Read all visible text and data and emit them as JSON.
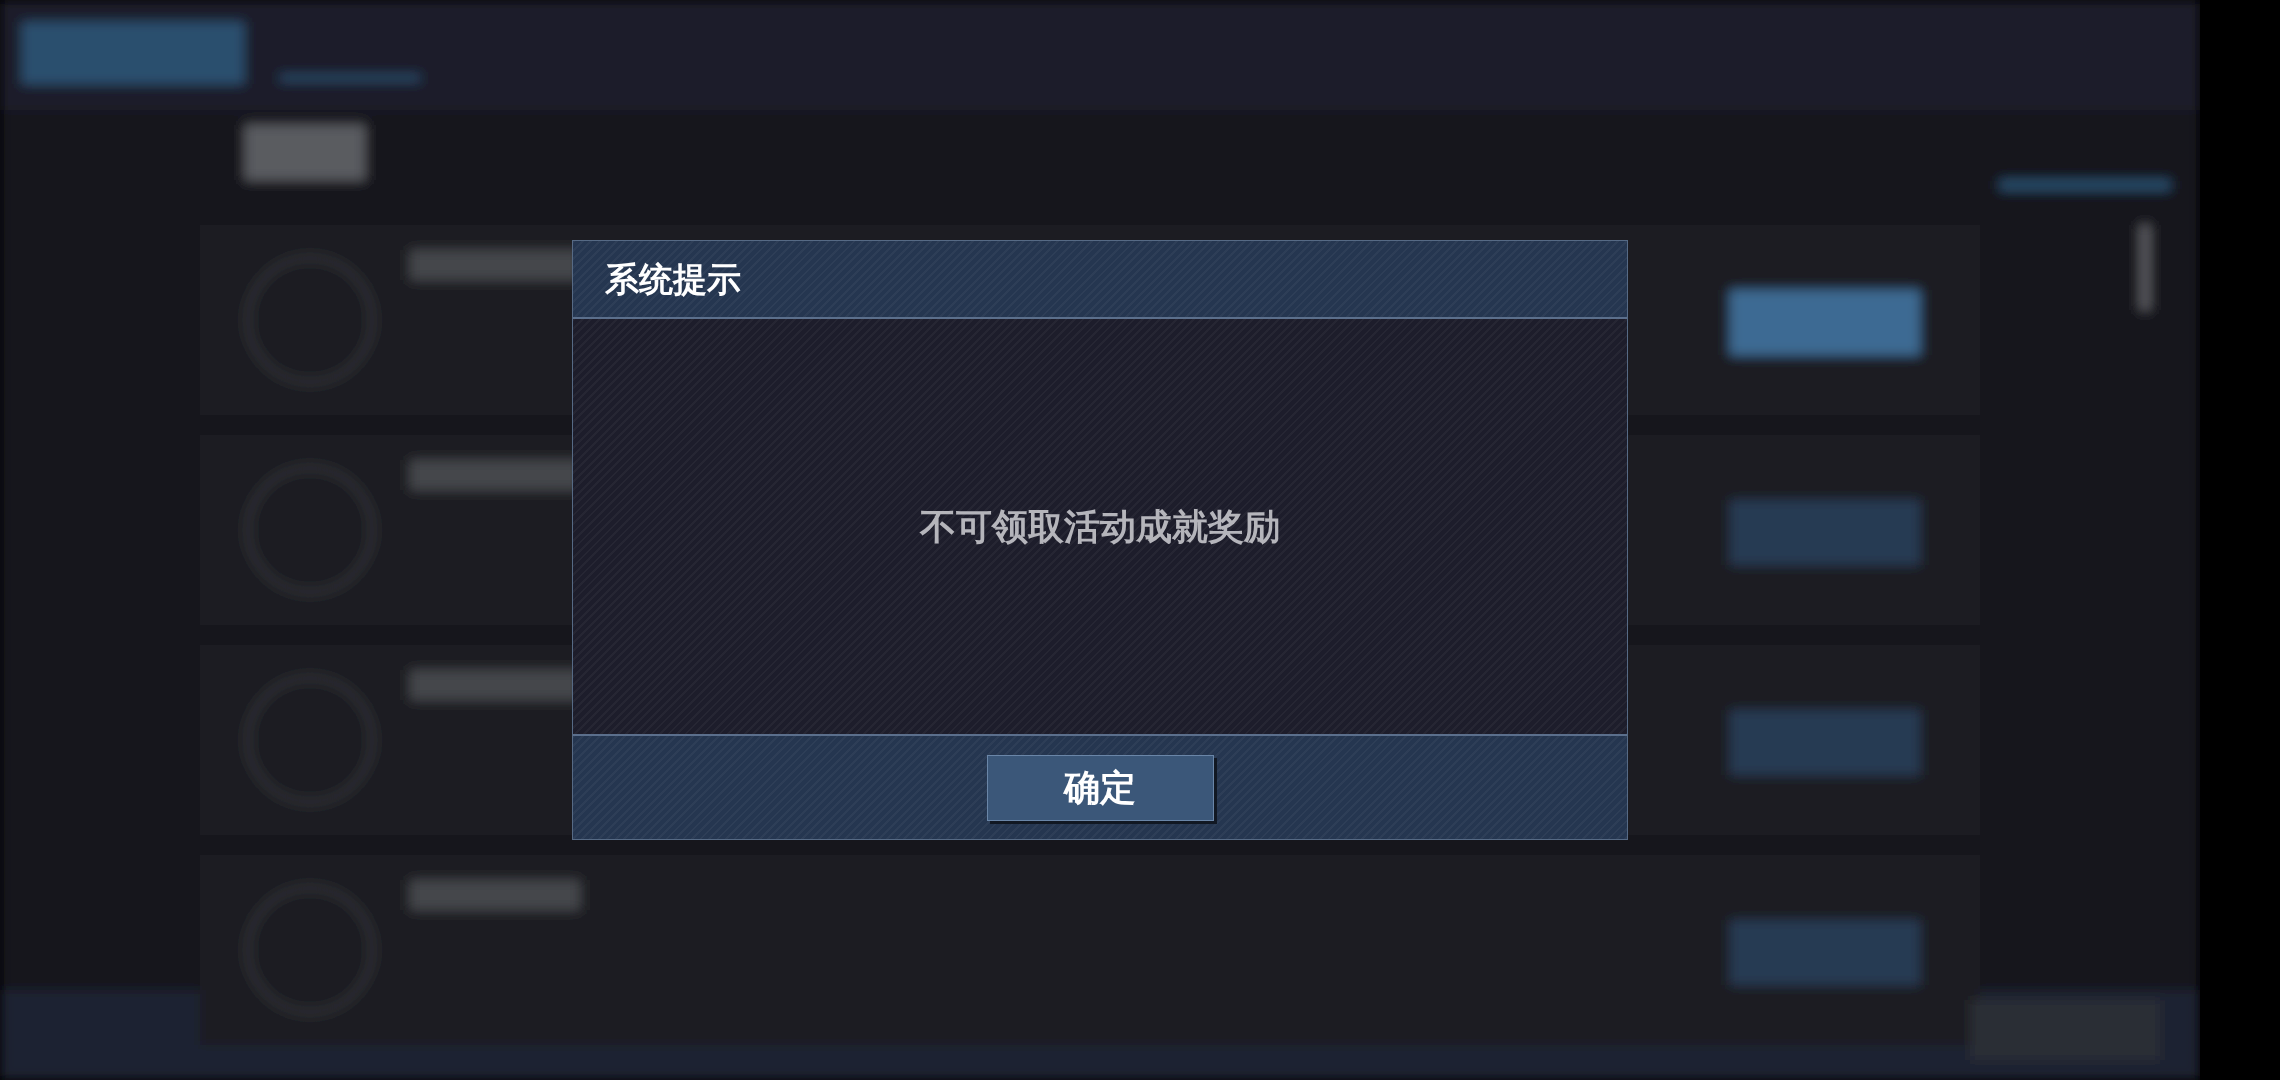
{
  "dialog": {
    "title": "系统提示",
    "message": "不可领取活动成就奖励",
    "buttons": [
      "确定"
    ]
  }
}
